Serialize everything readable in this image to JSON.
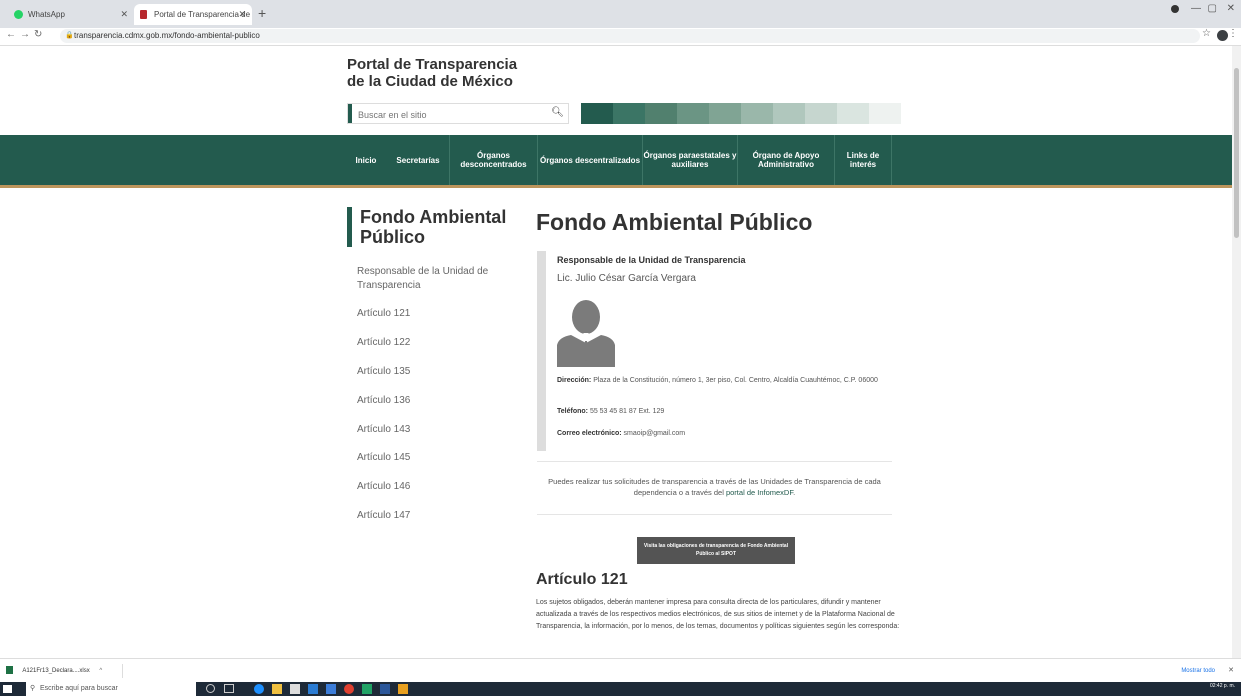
{
  "browser": {
    "tabs": [
      {
        "label": "WhatsApp"
      },
      {
        "label": "Portal de Transparencia de la CD"
      }
    ],
    "new_tab": "+",
    "window_controls": [
      "—",
      "▢",
      "✕"
    ],
    "url": "transparencia.cdmx.gob.mx/fondo-ambiental-publico"
  },
  "site": {
    "title_line1": "Portal de Transparencia",
    "title_line2": "de la Ciudad de México",
    "search_placeholder": "Buscar en el sitio",
    "swatch_colors": [
      "#235b4e",
      "#3b7565",
      "#51806e",
      "#6b9584",
      "#80a494",
      "#9ab7aa",
      "#b0c7bd",
      "#c6d6cf",
      "#dae5e0",
      "#eef2f0"
    ]
  },
  "nav": {
    "items": [
      {
        "label": "Inicio"
      },
      {
        "label": "Secretarías"
      },
      {
        "label": "Órganos desconcentrados"
      },
      {
        "label": "Órganos descentralizados"
      },
      {
        "label": "Órganos paraestatales y auxiliares"
      },
      {
        "label": "Órgano de Apoyo Administrativo"
      },
      {
        "label": "Links de interés"
      }
    ]
  },
  "sidebar": {
    "title": "Fondo Ambiental Público",
    "links": [
      "Responsable de la Unidad de Transparencia",
      "Artículo 121",
      "Artículo 122",
      "Artículo 135",
      "Artículo 136",
      "Artículo 143",
      "Artículo 145",
      "Artículo 146",
      "Artículo 147"
    ]
  },
  "main": {
    "title": "Fondo Ambiental Público",
    "responsible_heading": "Responsable de la Unidad de Transparencia",
    "responsible_name": "Lic. Julio César García Vergara",
    "address_label": "Dirección:",
    "address_value": "Plaza de la Constitución, número 1, 3er piso, Col. Centro, Alcaldía Cuauhtémoc, C.P. 06000",
    "phone_label": "Teléfono:",
    "phone_value": "55 53 45 81 87 Ext. 129",
    "email_label": "Correo electrónico:",
    "email_value": "smaoip@gmail.com",
    "note_text": "Puedes realizar tus solicitudes de transparencia a través de las Unidades de Transparencia de cada dependencia o a través del",
    "note_link": "portal de InfomexDF",
    "note_end": ".",
    "sipot_button": "Visita las obligaciones de transparencia de Fondo Ambiental Público al SIPOT",
    "article_title": "Artículo 121",
    "article_text": "Los sujetos obligados, deberán mantener impresa para consulta directa de los particulares, difundir y mantener actualizada a través de los respectivos medios electrónicos, de sus sitios de internet y de la Plataforma Nacional de Transparencia, la información, por lo menos, de los temas, documentos y políticas siguientes según les corresponda:"
  },
  "downloads": {
    "file": "A121Fr13_Declara....xlsx",
    "show_all": "Mostrar todo",
    "close": "✕"
  },
  "taskbar": {
    "search_placeholder": "Escribe aquí para buscar",
    "time": "02:42 p. m."
  }
}
